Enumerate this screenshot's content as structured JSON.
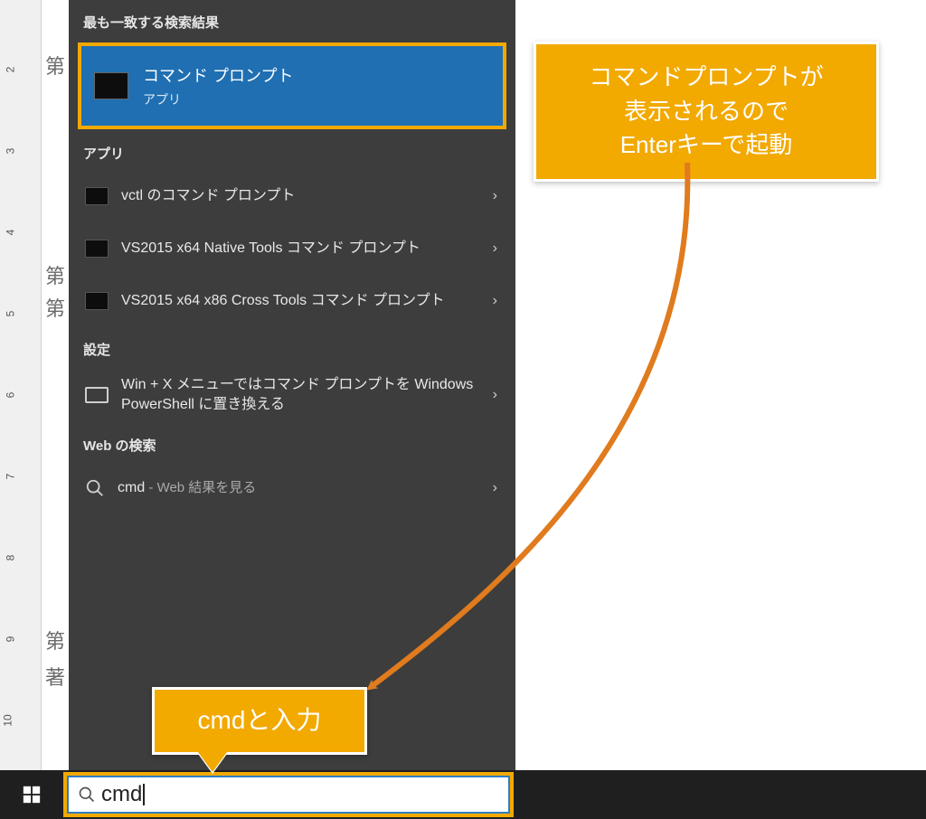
{
  "ruler": {
    "numbers": [
      "2",
      "3",
      "4",
      "5",
      "6",
      "7",
      "8",
      "9",
      "10"
    ]
  },
  "doc_headings": [
    "第",
    "第",
    "第",
    "第",
    "著"
  ],
  "panel": {
    "best_match_header": "最も一致する検索結果",
    "best_match": {
      "title": "コマンド プロンプト",
      "subtitle": "アプリ"
    },
    "apps_header": "アプリ",
    "apps": [
      {
        "label": "vctl のコマンド プロンプト"
      },
      {
        "label": "VS2015 x64 Native Tools コマンド プロンプト"
      },
      {
        "label": "VS2015 x64 x86 Cross Tools コマンド プロンプト"
      }
    ],
    "settings_header": "設定",
    "settings": [
      {
        "label": "Win + X メニューではコマンド プロンプトを Windows PowerShell に置き換える"
      }
    ],
    "web_header": "Web の検索",
    "web": [
      {
        "term": "cmd",
        "suffix": " - Web 結果を見る"
      }
    ]
  },
  "searchbox": {
    "value": "cmd"
  },
  "callouts": {
    "big_l1": "コマンドプロンプトが",
    "big_l2": "表示されるので",
    "big_l3": "Enterキーで起動",
    "small": "cmdと入力"
  },
  "colors": {
    "accent_orange": "#f2a900",
    "highlight_blue": "#1f6fb2",
    "arrow": "#e07b1e"
  }
}
